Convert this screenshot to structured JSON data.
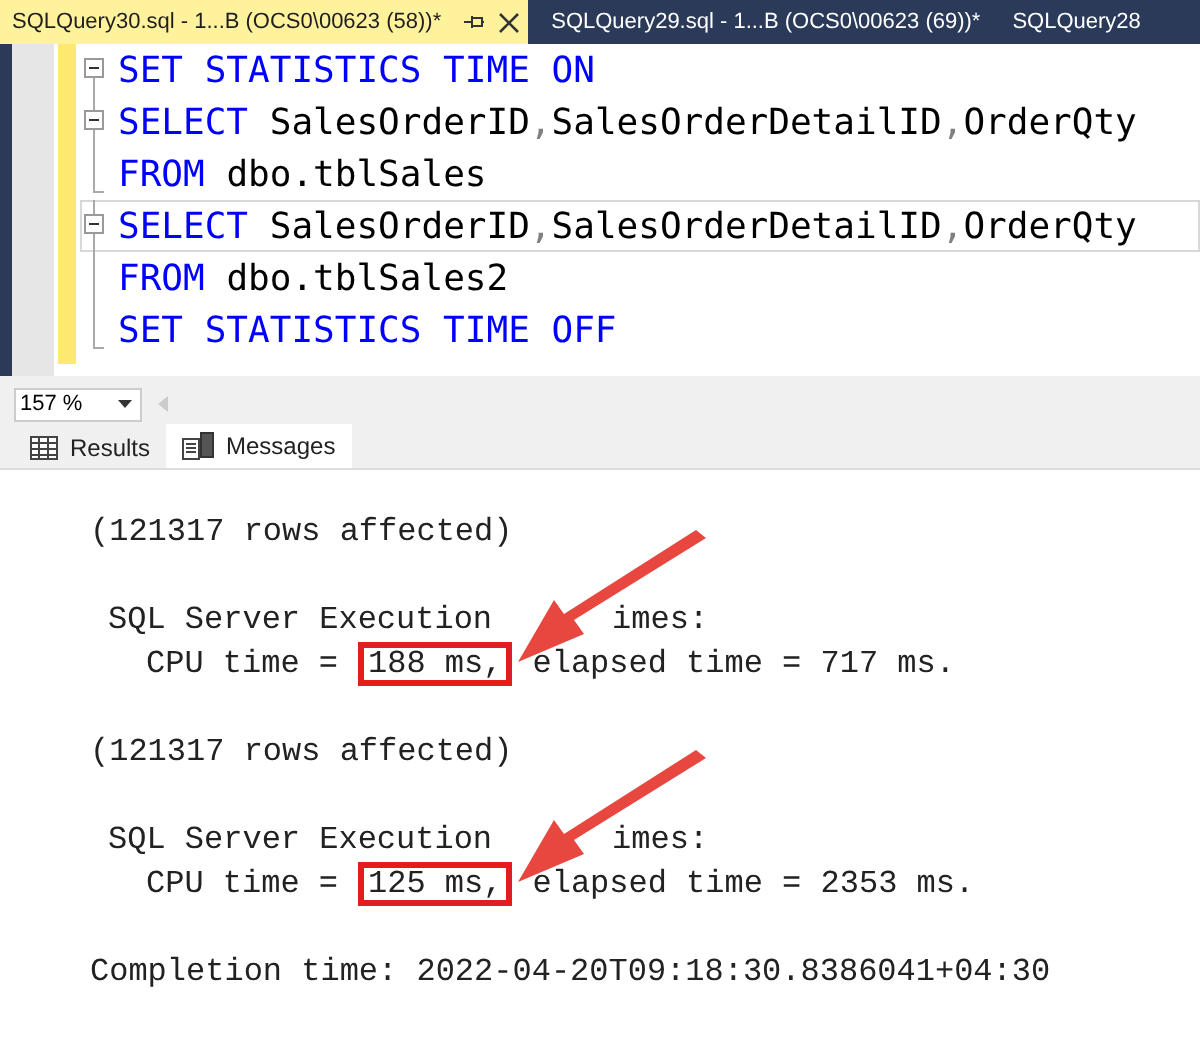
{
  "doc_tabs": [
    {
      "label": "SQLQuery30.sql - 1...B (OCS0\\00623 (58))*",
      "selected": true
    },
    {
      "label": "SQLQuery29.sql - 1...B (OCS0\\00623 (69))*",
      "selected": false
    },
    {
      "label": "SQLQuery28",
      "selected": false
    }
  ],
  "editor": {
    "lines": [
      {
        "fold": true,
        "current": false,
        "tokens": [
          {
            "kind": "keyword",
            "text": "SET STATISTICS TIME ON"
          }
        ]
      },
      {
        "fold": true,
        "current": false,
        "tokens": [
          {
            "kind": "keyword",
            "text": "SELECT"
          },
          {
            "kind": "plain",
            "text": " SalesOrderID"
          },
          {
            "kind": "punct",
            "text": ","
          },
          {
            "kind": "plain",
            "text": "SalesOrderDetailID"
          },
          {
            "kind": "punct",
            "text": ","
          },
          {
            "kind": "plain",
            "text": "OrderQty"
          }
        ]
      },
      {
        "fold": false,
        "current": false,
        "tokens": [
          {
            "kind": "keyword",
            "text": "FROM"
          },
          {
            "kind": "plain",
            "text": " dbo.tblSales"
          }
        ]
      },
      {
        "fold": true,
        "current": true,
        "tokens": [
          {
            "kind": "keyword",
            "text": "SELECT"
          },
          {
            "kind": "plain",
            "text": " SalesOrderID"
          },
          {
            "kind": "punct",
            "text": ","
          },
          {
            "kind": "plain",
            "text": "SalesOrderDetailID"
          },
          {
            "kind": "punct",
            "text": ","
          },
          {
            "kind": "plain",
            "text": "OrderQty"
          }
        ]
      },
      {
        "fold": false,
        "current": false,
        "tokens": [
          {
            "kind": "keyword",
            "text": "FROM"
          },
          {
            "kind": "plain",
            "text": " dbo.tblSales2"
          }
        ]
      },
      {
        "fold": false,
        "current": false,
        "tokens": [
          {
            "kind": "keyword",
            "text": "SET STATISTICS TIME OFF"
          }
        ]
      }
    ]
  },
  "zoom": "157 %",
  "result_tabs": [
    {
      "label": "Results",
      "kind": "grid",
      "selected": false
    },
    {
      "label": "Messages",
      "kind": "messages",
      "selected": true
    }
  ],
  "messages": {
    "blocks": [
      {
        "rows": "(121317 rows affected)",
        "header_left": "SQL Server Execution",
        "header_right": "imes:",
        "cpu_label": "CPU time =",
        "cpu_value": "188 ms,",
        "highlighted": true,
        "elapsed": "elapsed time = 717 ms."
      },
      {
        "rows": "(121317 rows affected)",
        "header_left": "SQL Server Execution",
        "header_right": "imes:",
        "cpu_label": "CPU time =",
        "cpu_value": "125 ms,",
        "highlighted": true,
        "elapsed": "elapsed time = 2353 ms."
      }
    ],
    "completion": "Completion time: 2022-04-20T09:18:30.8386041+04:30"
  }
}
